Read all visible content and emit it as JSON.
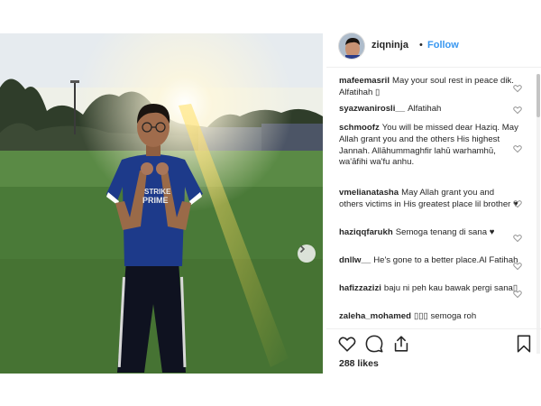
{
  "post": {
    "username": "ziqninja",
    "separator": "•",
    "follow_label": "Follow",
    "likes": "288 likes"
  },
  "comments": [
    {
      "user": "mafeemasril",
      "text": "May your soul rest in peace dik. Alfatihah ▯"
    },
    {
      "user": "syazwanirosli__",
      "text": "Alfatihah"
    },
    {
      "user": "schmoofz",
      "text": "You will be missed dear Haziq. May Allah grant you and the others His highest Jannah. Allāhummaghfir lahū warhamhū, wa'āfihi wa'fu anhu."
    },
    {
      "user": "vmelianatasha",
      "text": "May Allah grant you and others victims in His greatest place lil brother ♥"
    },
    {
      "user": "haziqqfarukh",
      "text": "Semoga tenang di sana ♥"
    },
    {
      "user": "dnllw__",
      "text": "He's gone to a better place.Al Fatihah"
    },
    {
      "user": "hafizzazizi",
      "text": "baju ni peh kau bawak pergi sana▯"
    },
    {
      "user": "zaleha_mohamed",
      "text": "▯▯▯ semoga roh"
    }
  ],
  "jersey_text": "PRIME",
  "icons": {
    "like": "heart-icon",
    "comment": "comment-icon",
    "share": "share-icon",
    "save": "bookmark-icon",
    "next": "chevron-right-icon"
  },
  "colors": {
    "link_blue": "#3897f0",
    "text": "#262626",
    "divider": "#efefef"
  }
}
